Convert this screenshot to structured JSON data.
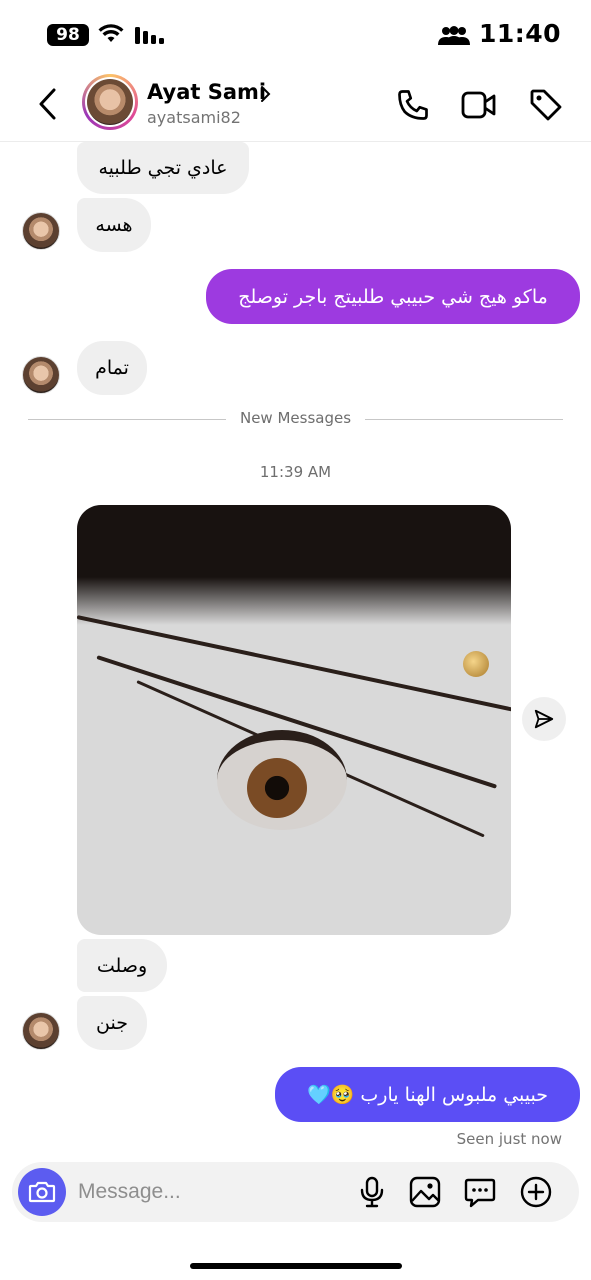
{
  "status_bar": {
    "battery": "98",
    "time": "11:40",
    "icons": [
      "wifi-icon",
      "signal-icon",
      "people-icon"
    ]
  },
  "header": {
    "name": "Ayat Sami",
    "username": "ayatsami82",
    "icons": [
      "back-icon",
      "chevron-right-icon",
      "phone-icon",
      "video-camera-icon",
      "tag-icon"
    ]
  },
  "messages": {
    "m1": "عادي تجي طلبيه",
    "m2": "هسه",
    "m3": "ماكو هيج شي حبيبي طلبيتج باجر توصلج",
    "m4": "تمام",
    "m5": "وصلت",
    "m6": "جنن",
    "m7": "حبيبي ملبوس الهنا يارب 🥹🩵"
  },
  "divider": {
    "label": "New Messages"
  },
  "timestamp": "11:39 AM",
  "seen": "Seen just now",
  "composer": {
    "placeholder": "Message...",
    "icons": [
      "camera-icon",
      "microphone-icon",
      "gallery-icon",
      "sticker-icon",
      "plus-icon"
    ]
  },
  "colors": {
    "outgoing_purple": "#9d3ae0",
    "outgoing_blue": "#5b4ef5",
    "incoming": "#efefef",
    "camera_button": "#5c5cf0"
  }
}
